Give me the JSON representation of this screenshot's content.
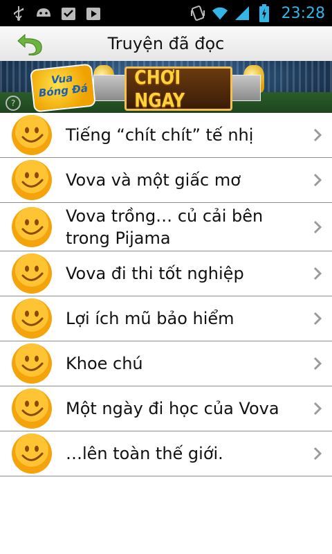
{
  "status_bar": {
    "time": "23:28",
    "icons": [
      "usb-icon",
      "android-debug-icon",
      "download-done-icon",
      "play-store-icon",
      "vibrate-icon",
      "wifi-icon",
      "signal-icon",
      "battery-charging-icon"
    ]
  },
  "header": {
    "title": "Truyện đã đọc",
    "back_icon": "back-arrow-icon"
  },
  "banner": {
    "logo_text": "Vua Bóng Đá",
    "cta_text": "CHƠI NGAY"
  },
  "stories": [
    {
      "title": "Tiếng “chít chít” tế nhị"
    },
    {
      "title": "Vova và một giấc mơ"
    },
    {
      "title": "Vova trồng… củ cải bên trong Pijama"
    },
    {
      "title": "Vova đi thi tốt nghiệp"
    },
    {
      "title": "Lợi ích mũ bảo hiểm"
    },
    {
      "title": "Khoe chú"
    },
    {
      "title": "Một ngày đi học của Vova"
    },
    {
      "title": "…lên toàn thế giới."
    }
  ],
  "colors": {
    "clock": "#33b5e5",
    "back_arrow": "#6db33f",
    "smiley": "#f5a30a"
  }
}
